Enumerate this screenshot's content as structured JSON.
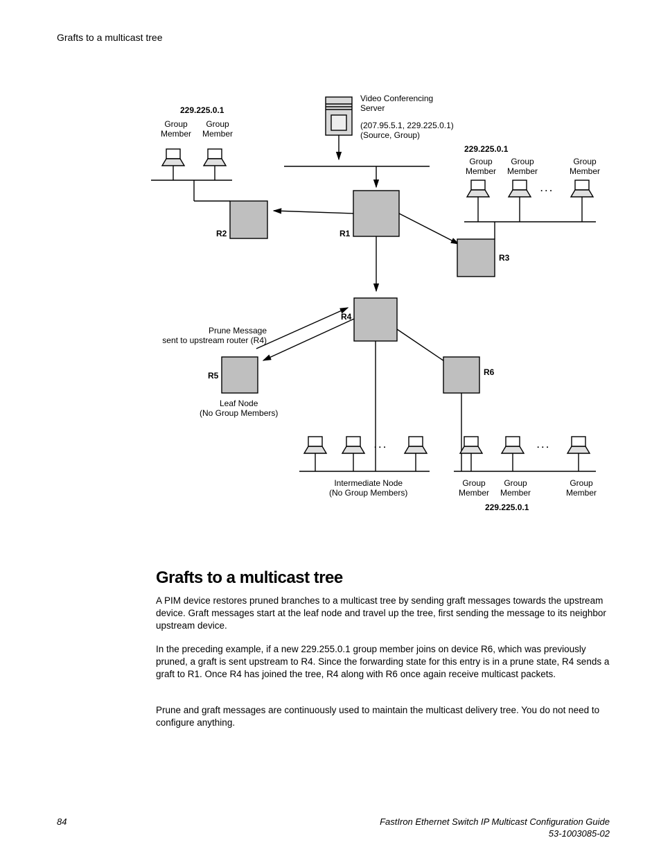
{
  "header": {
    "title": "Grafts to a multicast tree"
  },
  "diagram": {
    "group_addr_left": "229.225.0.1",
    "group_addr_right": "229.225.0.1",
    "group_addr_bottom": "229.225.0.1",
    "group_member": "Group\nMember",
    "server_title": "Video Conferencing\nServer",
    "server_sub": "(207.95.5.1, 229.225.0.1)\n(Source, Group)",
    "r1": "R1",
    "r2": "R2",
    "r3": "R3",
    "r4": "R4",
    "r5": "R5",
    "r6": "R6",
    "prune_msg": "Prune Message\nsent to upstream router (R4)",
    "leaf_node": "Leaf Node\n(No Group Members)",
    "inter_node": "Intermediate Node\n(No Group Members)",
    "dots": ". . ."
  },
  "section": {
    "title": "Grafts to a multicast tree"
  },
  "paragraphs": {
    "p1": "A PIM device restores pruned branches to a multicast tree by sending graft messages towards the upstream device. Graft messages start at the leaf node and travel up the tree, first sending the message to its neighbor upstream device.",
    "p2": "In the preceding example, if a new 229.255.0.1 group member joins on device R6, which was previously pruned, a graft is sent upstream to R4. Since the forwarding state for this entry is in a prune state, R4 sends a graft to R1. Once R4 has joined the tree, R4 along with R6 once again receive multicast packets.",
    "p3": "Prune and graft messages are continuously used to maintain the multicast delivery tree. You do not need to configure anything."
  },
  "footer": {
    "page": "84",
    "guide": "FastIron Ethernet Switch IP Multicast Configuration Guide",
    "docnum": "53-1003085-02"
  }
}
